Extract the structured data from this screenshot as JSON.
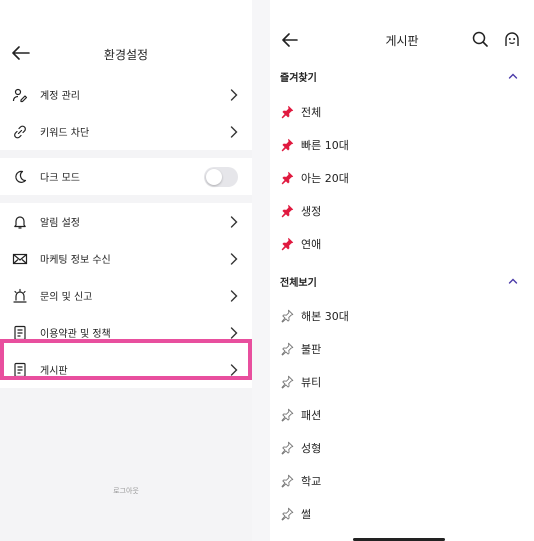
{
  "settings": {
    "title": "환경설정",
    "group1": [
      {
        "label": "계정 관리",
        "icon": "account-icon"
      },
      {
        "label": "키워드 차단",
        "icon": "keyword-block-icon"
      }
    ],
    "dark_mode": {
      "label": "다크 모드",
      "icon": "moon-icon",
      "enabled": false
    },
    "group3": [
      {
        "label": "알림 설정",
        "icon": "bell-icon"
      },
      {
        "label": "마케팅 정보 수신",
        "icon": "mail-icon"
      },
      {
        "label": "문의 및 신고",
        "icon": "report-icon"
      },
      {
        "label": "이용약관 및 정책",
        "icon": "document-icon"
      },
      {
        "label": "게시판",
        "icon": "board-icon"
      }
    ],
    "logout_label": "로그아웃"
  },
  "board": {
    "title": "게시판",
    "favorites": {
      "title": "즐겨찾기",
      "items": [
        "전체",
        "빠른 10대",
        "아는 20대",
        "생정",
        "연애"
      ]
    },
    "all": {
      "title": "전체보기",
      "items": [
        "해본 30대",
        "불판",
        "뷰티",
        "패션",
        "성형",
        "학교",
        "썰"
      ]
    }
  },
  "colors": {
    "accent": "#4a3aa8",
    "pin_active": "#e0193f",
    "highlight": "#e84f9e"
  }
}
